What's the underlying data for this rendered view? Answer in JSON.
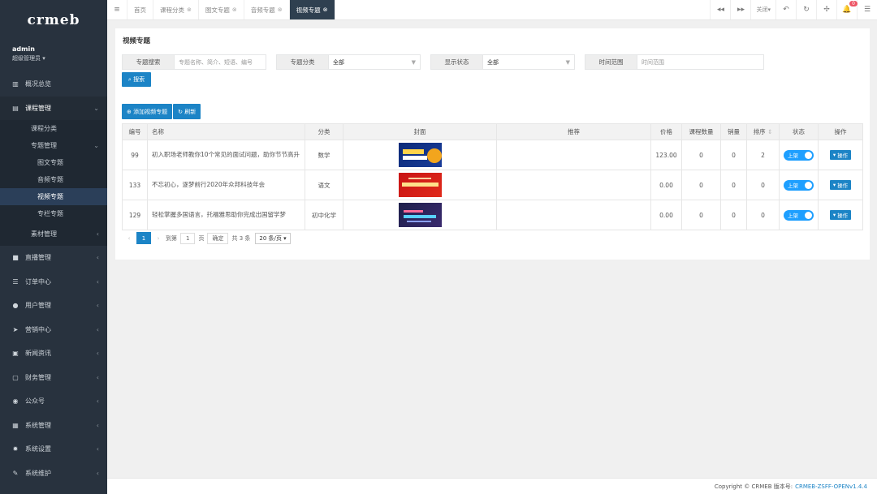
{
  "logo": "crmeb",
  "user": {
    "name": "admin",
    "role": "超级管理员 ▾"
  },
  "sidebar": {
    "overview": "概况总览",
    "course": "课程管理",
    "course_category": "课程分类",
    "topic_manage": "专题管理",
    "topic_items": [
      "图文专题",
      "音频专题",
      "视频专题",
      "专栏专题"
    ],
    "material": "素材管理",
    "items": [
      "直播管理",
      "订单中心",
      "用户管理",
      "营销中心",
      "新闻资讯",
      "财务管理",
      "公众号",
      "系统管理",
      "系统设置",
      "系统维护"
    ]
  },
  "topbar": {
    "tabs": [
      "首页",
      "课程分类",
      "图文专题",
      "音频专题",
      "视频专题"
    ],
    "close_label": "关闭▾",
    "badge": "0"
  },
  "page": {
    "title": "视频专题"
  },
  "filters": {
    "search_label": "专题搜索",
    "search_placeholder": "专题名称、简介、短语、编号",
    "category_label": "专题分类",
    "category_value": "全部",
    "status_label": "显示状态",
    "status_value": "全部",
    "time_label": "时间范围",
    "time_placeholder": "时间范围",
    "search_button": "搜索"
  },
  "actions": {
    "add": "添加视频专题",
    "refresh": "刷新"
  },
  "table": {
    "headers": [
      "编号",
      "名称",
      "分类",
      "封面",
      "推荐",
      "价格",
      "课程数量",
      "销量",
      "排序",
      "状态",
      "操作"
    ],
    "rows": [
      {
        "id": "99",
        "name": "初入职场老师教你10个常见的面试问题，助你节节高升",
        "category": "数学",
        "price": "123.00",
        "courses": "0",
        "sales": "0",
        "sort": "2",
        "status": "上架",
        "op": "操作",
        "cover_text": "10个常见面试问题"
      },
      {
        "id": "133",
        "name": "不忘初心，逐梦前行2020年众邦科技年会",
        "category": "语文",
        "price": "0.00",
        "courses": "0",
        "sales": "0",
        "sort": "0",
        "status": "上架",
        "op": "操作",
        "cover_text": "不忘初心 逐梦前行"
      },
      {
        "id": "129",
        "name": "轻松掌握多国语言，托福雅思助你完成出国留学梦",
        "category": "初中化学",
        "price": "0.00",
        "courses": "0",
        "sales": "0",
        "sort": "0",
        "status": "上架",
        "op": "操作",
        "cover_text": "托福雅思"
      }
    ]
  },
  "pager": {
    "current": "1",
    "goto": "到第",
    "page_input": "1",
    "page_unit": "页",
    "confirm": "确定",
    "total": "共 3 条",
    "per_page": "20 条/页 ▾"
  },
  "footer": {
    "copyright": "Copyright © CRMEB 版本号:",
    "version": "CRMEB-ZSFF-OPENv1.4.4"
  }
}
